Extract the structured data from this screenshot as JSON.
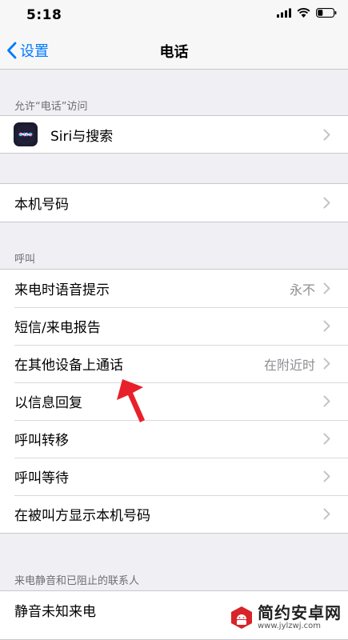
{
  "status_bar": {
    "time": "5:18"
  },
  "nav": {
    "back_label": "设置",
    "title": "电话"
  },
  "section_access": {
    "header": "允许“电话”访问",
    "items": [
      {
        "label": "Siri与搜索",
        "icon": "siri-icon"
      }
    ]
  },
  "section_number": {
    "items": [
      {
        "label": "本机号码"
      }
    ]
  },
  "section_calls": {
    "header": "呼叫",
    "items": [
      {
        "label": "来电时语音提示",
        "value": "永不"
      },
      {
        "label": "短信/来电报告"
      },
      {
        "label": "在其他设备上通话",
        "value": "在附近时"
      },
      {
        "label": "以信息回复"
      },
      {
        "label": "呼叫转移"
      },
      {
        "label": "呼叫等待"
      },
      {
        "label": "在被叫方显示本机号码"
      }
    ]
  },
  "section_silence": {
    "header": "来电静音和已阻止的联系人",
    "items": [
      {
        "label": "静音未知来电"
      }
    ]
  },
  "watermark": {
    "title": "简约安卓网",
    "url": "www.jylzwj.com"
  },
  "colors": {
    "accent": "#007aff",
    "annotation_arrow": "#e8202a",
    "background": "#efeff4"
  }
}
